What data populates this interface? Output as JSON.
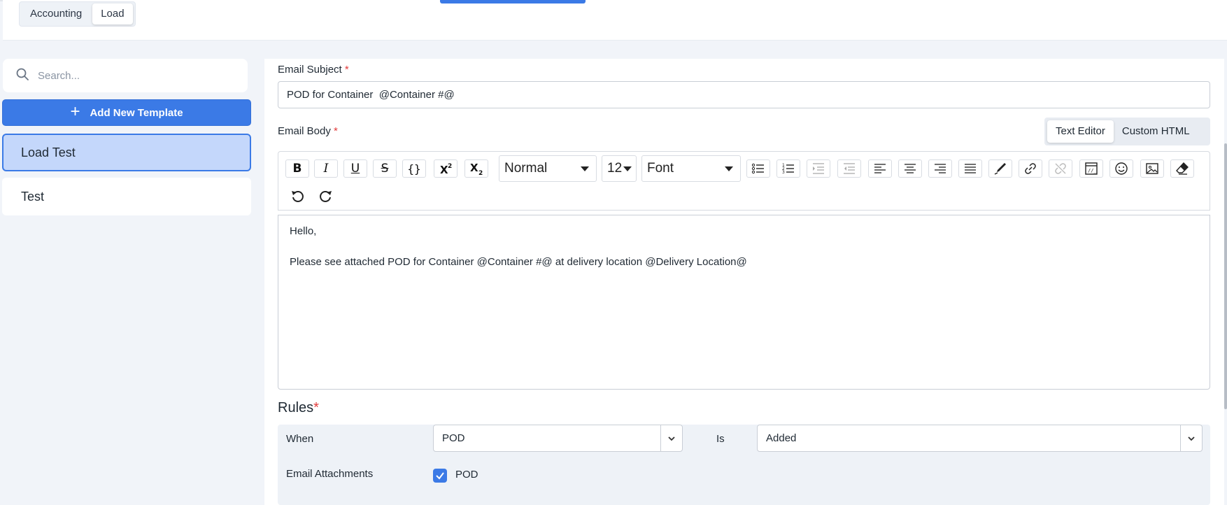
{
  "header": {
    "tabs": [
      {
        "label": "Accounting",
        "active": false
      },
      {
        "label": "Load",
        "active": true
      }
    ]
  },
  "sidebar": {
    "search": {
      "placeholder": "Search...",
      "value": ""
    },
    "add_button": {
      "label": "Add New Template"
    },
    "templates": [
      {
        "label": "Load Test",
        "selected": true
      },
      {
        "label": "Test",
        "selected": false
      }
    ]
  },
  "form": {
    "subject": {
      "label": "Email Subject",
      "required_mark": "*",
      "value": "POD for Container  @Container #@"
    },
    "body": {
      "label": "Email Body",
      "required_mark": "*",
      "editor_modes": [
        {
          "label": "Text Editor",
          "active": true
        },
        {
          "label": "Custom HTML",
          "active": false
        }
      ],
      "toolbar": {
        "bold": "B",
        "italic": "I",
        "underline": "U",
        "strike": "S",
        "code": "{}",
        "format_value": "Normal",
        "size_value": "12",
        "font_value": "Font"
      },
      "content": [
        "Hello,",
        "Please see attached POD for Container @Container #@ at delivery location @Delivery Location@"
      ]
    },
    "rules": {
      "title": "Rules",
      "required_mark": "*",
      "when_label": "When",
      "when_value": "POD",
      "is_label": "Is",
      "is_value": "Added",
      "attachments_label": "Email Attachments",
      "attachment_option": {
        "label": "POD",
        "checked": true
      }
    }
  },
  "colors": {
    "accent": "#3b7ae6",
    "selected_bg": "#c4d7fb",
    "required": "#e23b3b"
  }
}
